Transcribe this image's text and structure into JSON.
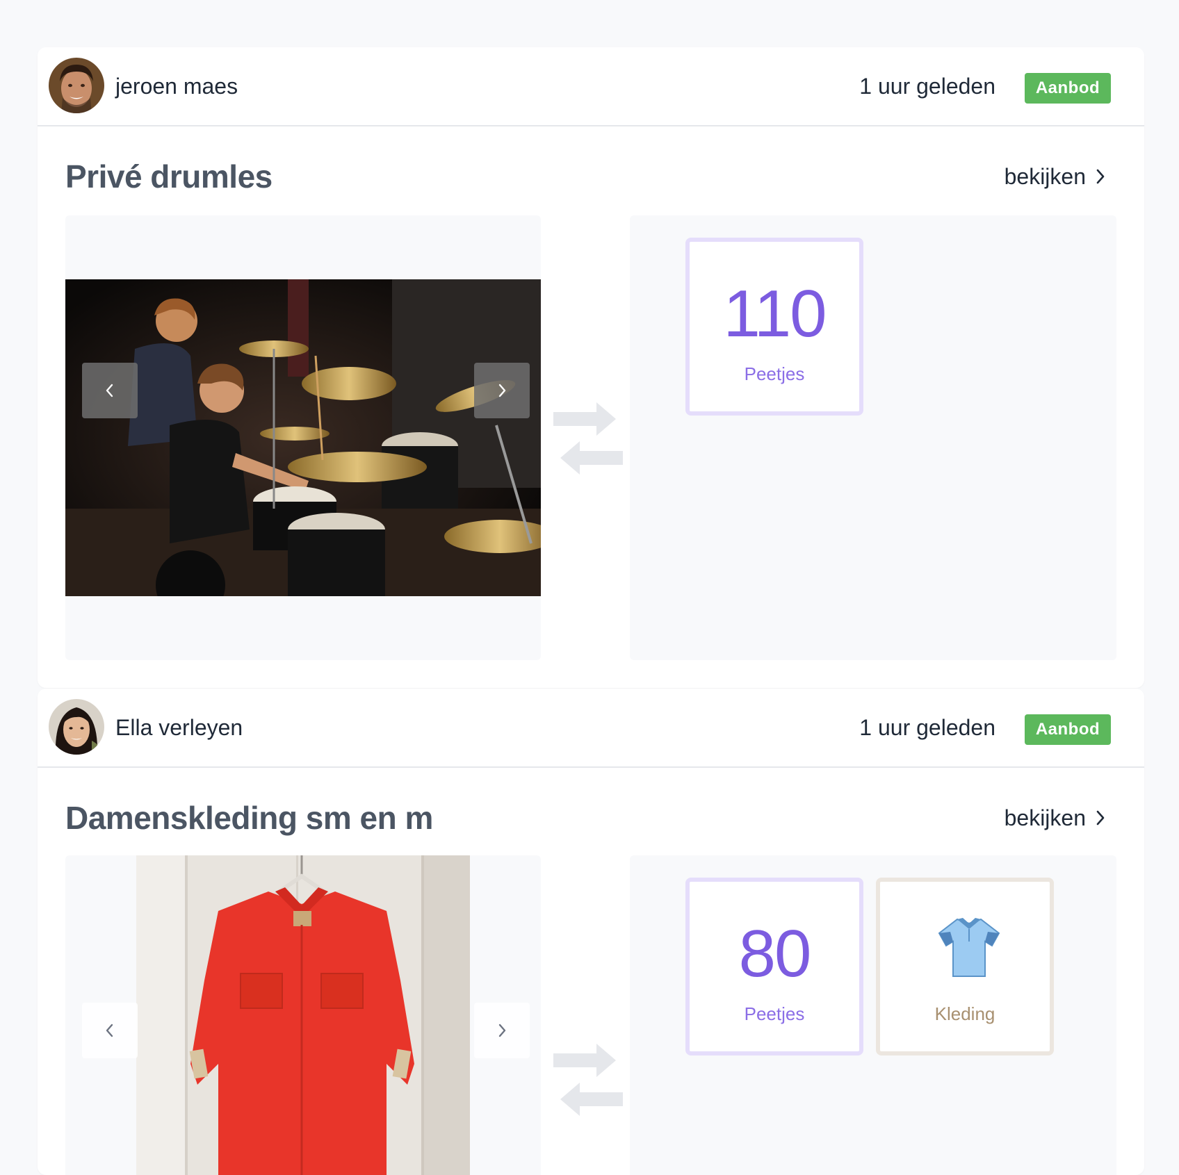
{
  "posts": [
    {
      "user": "jeroen maes",
      "time": "1 uur geleden",
      "badge": "Aanbod",
      "title": "Privé drumles",
      "view_label": "bekijken",
      "offer": {
        "amount": "110",
        "unit": "Peetjes"
      }
    },
    {
      "user": "Ella verleyen",
      "time": "1 uur geleden",
      "badge": "Aanbod",
      "title": "Damenskleding sm en m",
      "view_label": "bekijken",
      "offer": {
        "amount": "80",
        "unit": "Peetjes"
      },
      "category": {
        "label": "Kleding",
        "icon": "tshirt-icon"
      }
    }
  ],
  "colors": {
    "badge": "#5cb85c",
    "accent_purple": "#7c5ce0",
    "category_brown": "#a89070"
  }
}
